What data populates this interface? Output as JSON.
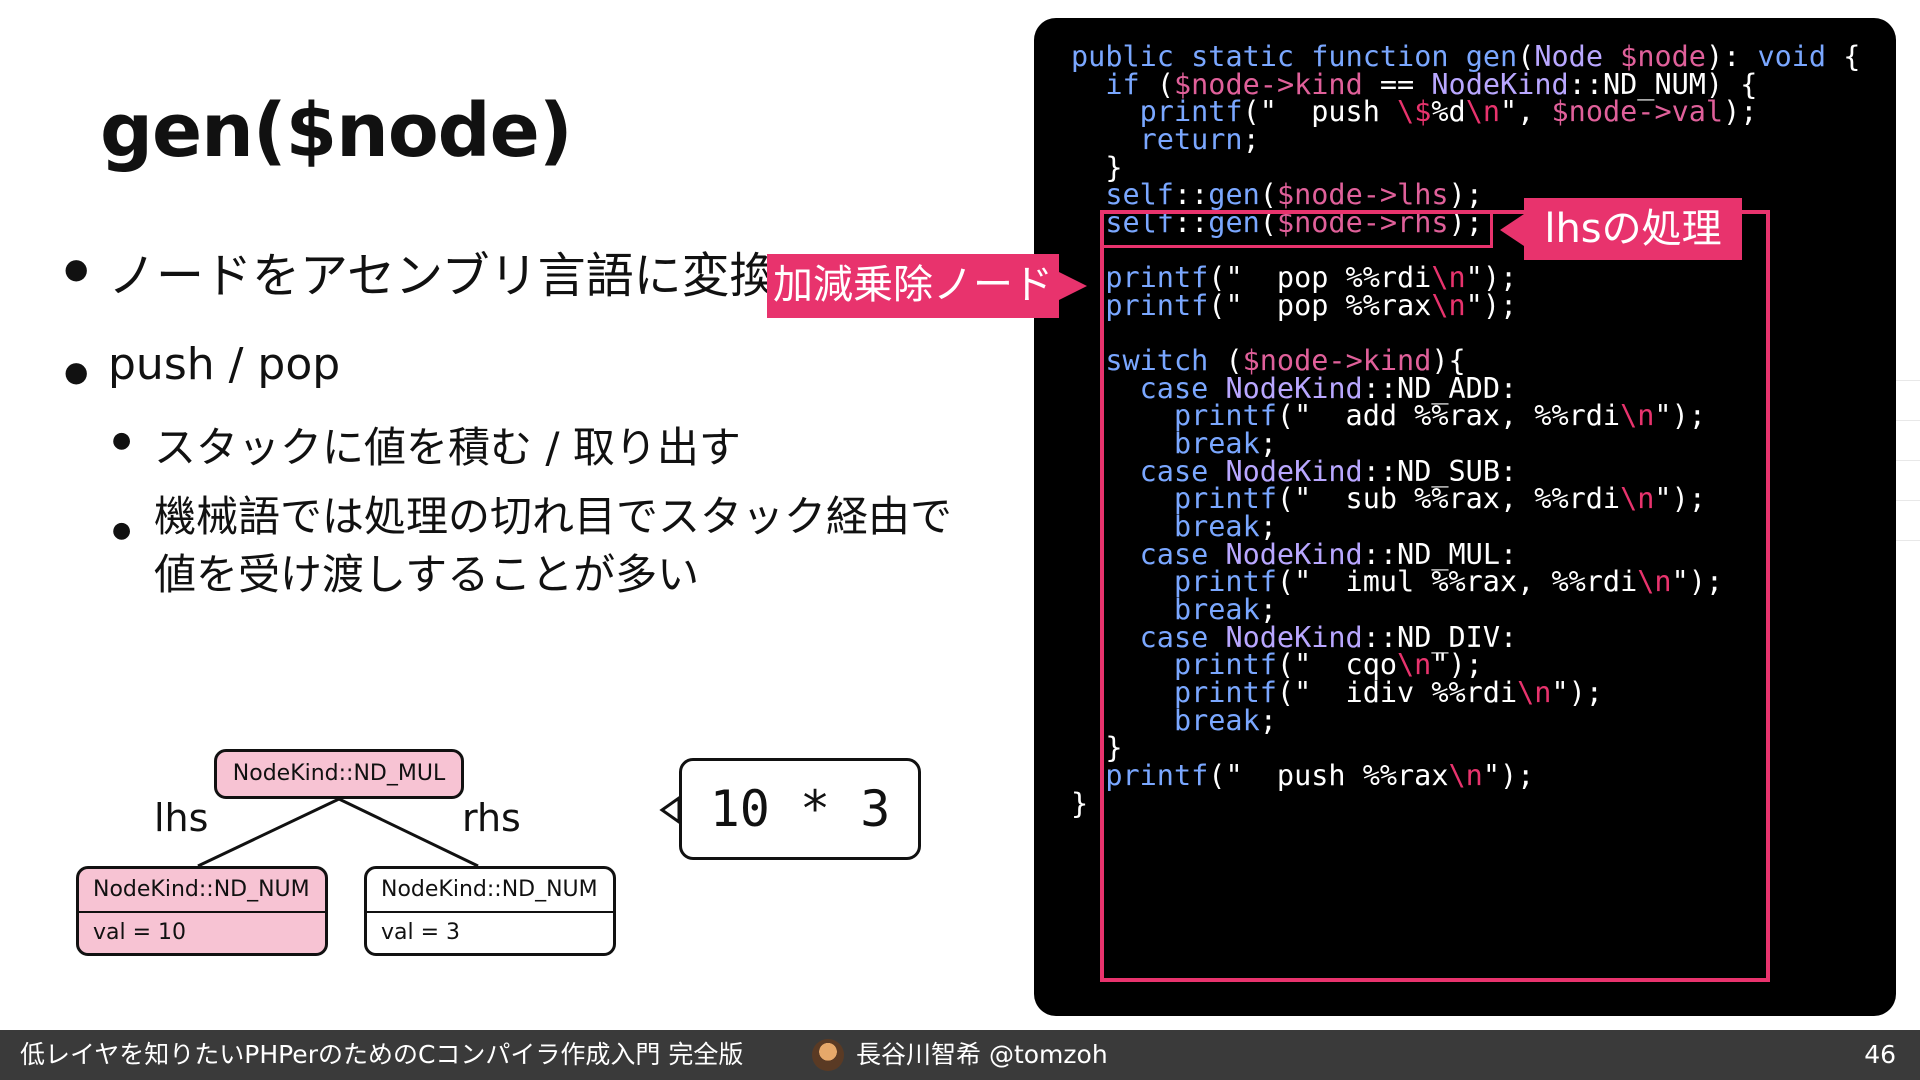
{
  "slide": {
    "title": "gen($node)",
    "bullets": [
      "ノードをアセンブリ言語に変換",
      "push / pop",
      "スタックに値を積む / 取り出す",
      "機械語では処理の切れ目でスタック経由で",
      "値を受け渡しすることが多い"
    ]
  },
  "diagram": {
    "root": "NodeKind::ND_MUL",
    "lhs_label": "lhs",
    "rhs_label": "rhs",
    "lhs_node": {
      "kind": "NodeKind::ND_NUM",
      "val": "val = 10"
    },
    "rhs_node": {
      "kind": "NodeKind::ND_NUM",
      "val": "val = 3"
    },
    "expression": "10 * 3"
  },
  "code": {
    "lines": [
      "public static function gen(Node $node): void {",
      "  if ($node->kind == NodeKind::ND_NUM) {",
      "    printf(\"  push \\$%d\\n\", $node->val);",
      "    return;",
      "  }",
      "  self::gen($node->lhs);",
      "  self::gen($node->rhs);",
      "",
      "  printf(\"  pop %%rdi\\n\");",
      "  printf(\"  pop %%rax\\n\");",
      "",
      "  switch ($node->kind){",
      "    case NodeKind::ND_ADD:",
      "      printf(\"  add %%rax, %%rdi\\n\");",
      "      break;",
      "    case NodeKind::ND_SUB:",
      "      printf(\"  sub %%rax, %%rdi\\n\");",
      "      break;",
      "    case NodeKind::ND_MUL:",
      "      printf(\"  imul %%rax, %%rdi\\n\");",
      "      break;",
      "    case NodeKind::ND_DIV:",
      "      printf(\"  cqo\\n\");",
      "      printf(\"  idiv %%rdi\\n\");",
      "      break;",
      "  }",
      "  printf(\"  push %%rax\\n\");",
      "}"
    ]
  },
  "callouts": {
    "lhs": "lhsの処理",
    "op": "加減乗除ノード"
  },
  "footer": {
    "presentation": "低レイヤを知りたいPHPerのためのCコンパイラ作成入門 完全版",
    "author": "長谷川智希 @tomzoh",
    "page": "46"
  },
  "colors": {
    "accent": "#e8336d",
    "node_pink": "#f7c3d3",
    "code_bg": "#000000",
    "keyword": "#7aa7ff",
    "variable": "#e0609a",
    "type": "#b9a7ff",
    "footer_bg": "#3a3a3a"
  }
}
